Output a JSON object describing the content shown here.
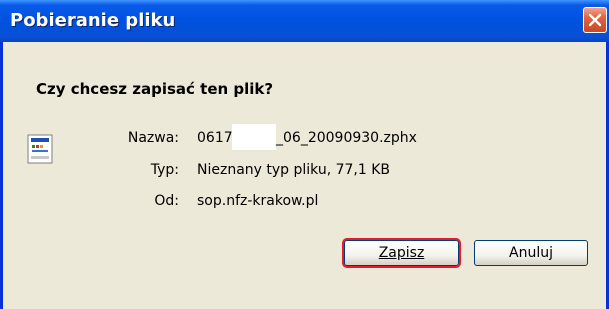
{
  "window": {
    "title": "Pobieranie pliku"
  },
  "dialog": {
    "question": "Czy chcesz zapisać ten plik?",
    "fields": {
      "name_label": "Nazwa:",
      "name_prefix": "0617",
      "name_suffix": "_06_20090930.zphx",
      "type_label": "Typ:",
      "type_value": "Nieznany typ pliku, 77,1 KB",
      "from_label": "Od:",
      "from_value": "sop.nfz-krakow.pl"
    }
  },
  "buttons": {
    "save_label": "Zapisz",
    "cancel_label": "Anuluj"
  },
  "colors": {
    "titlebar": "#0053e1",
    "dialog_bg": "#ece9d8",
    "highlight": "#e8192c"
  },
  "icons": {
    "close": "close-icon",
    "file": "file-icon"
  }
}
